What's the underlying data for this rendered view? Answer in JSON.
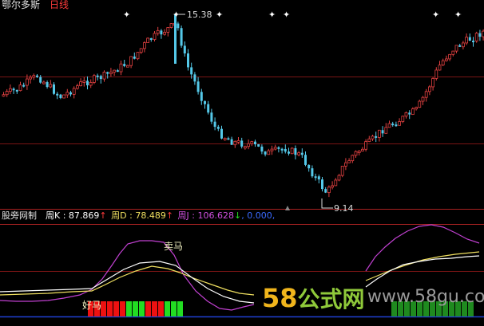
{
  "header": {
    "stock_name": "鄂尔多斯",
    "period": "日线"
  },
  "price_chart": {
    "high_label": "15.38",
    "low_label": "9.14",
    "signal_marker": "✦"
  },
  "indicator": {
    "name": "股旁网制",
    "k_label": "周K",
    "k_value": "87.869",
    "k_arrow": "↑",
    "d_label": "周D",
    "d_value": "78.489",
    "d_arrow": "↑",
    "j_label": "周J",
    "j_value": "106.628",
    "j_arrow": "↓",
    "extra_value": "0.000",
    "sell_label": "卖马",
    "buy_label": "好马"
  },
  "watermark": {
    "num": "58",
    "cn": "公式网",
    "url": "www.58gu.com"
  },
  "colors": {
    "up": "#e04040",
    "down": "#54c8e8",
    "k_line": "#ffffff",
    "d_line": "#f0e060",
    "j_line": "#c040d0",
    "bar_red": "#ee1111",
    "bar_green": "#22dd22"
  }
}
